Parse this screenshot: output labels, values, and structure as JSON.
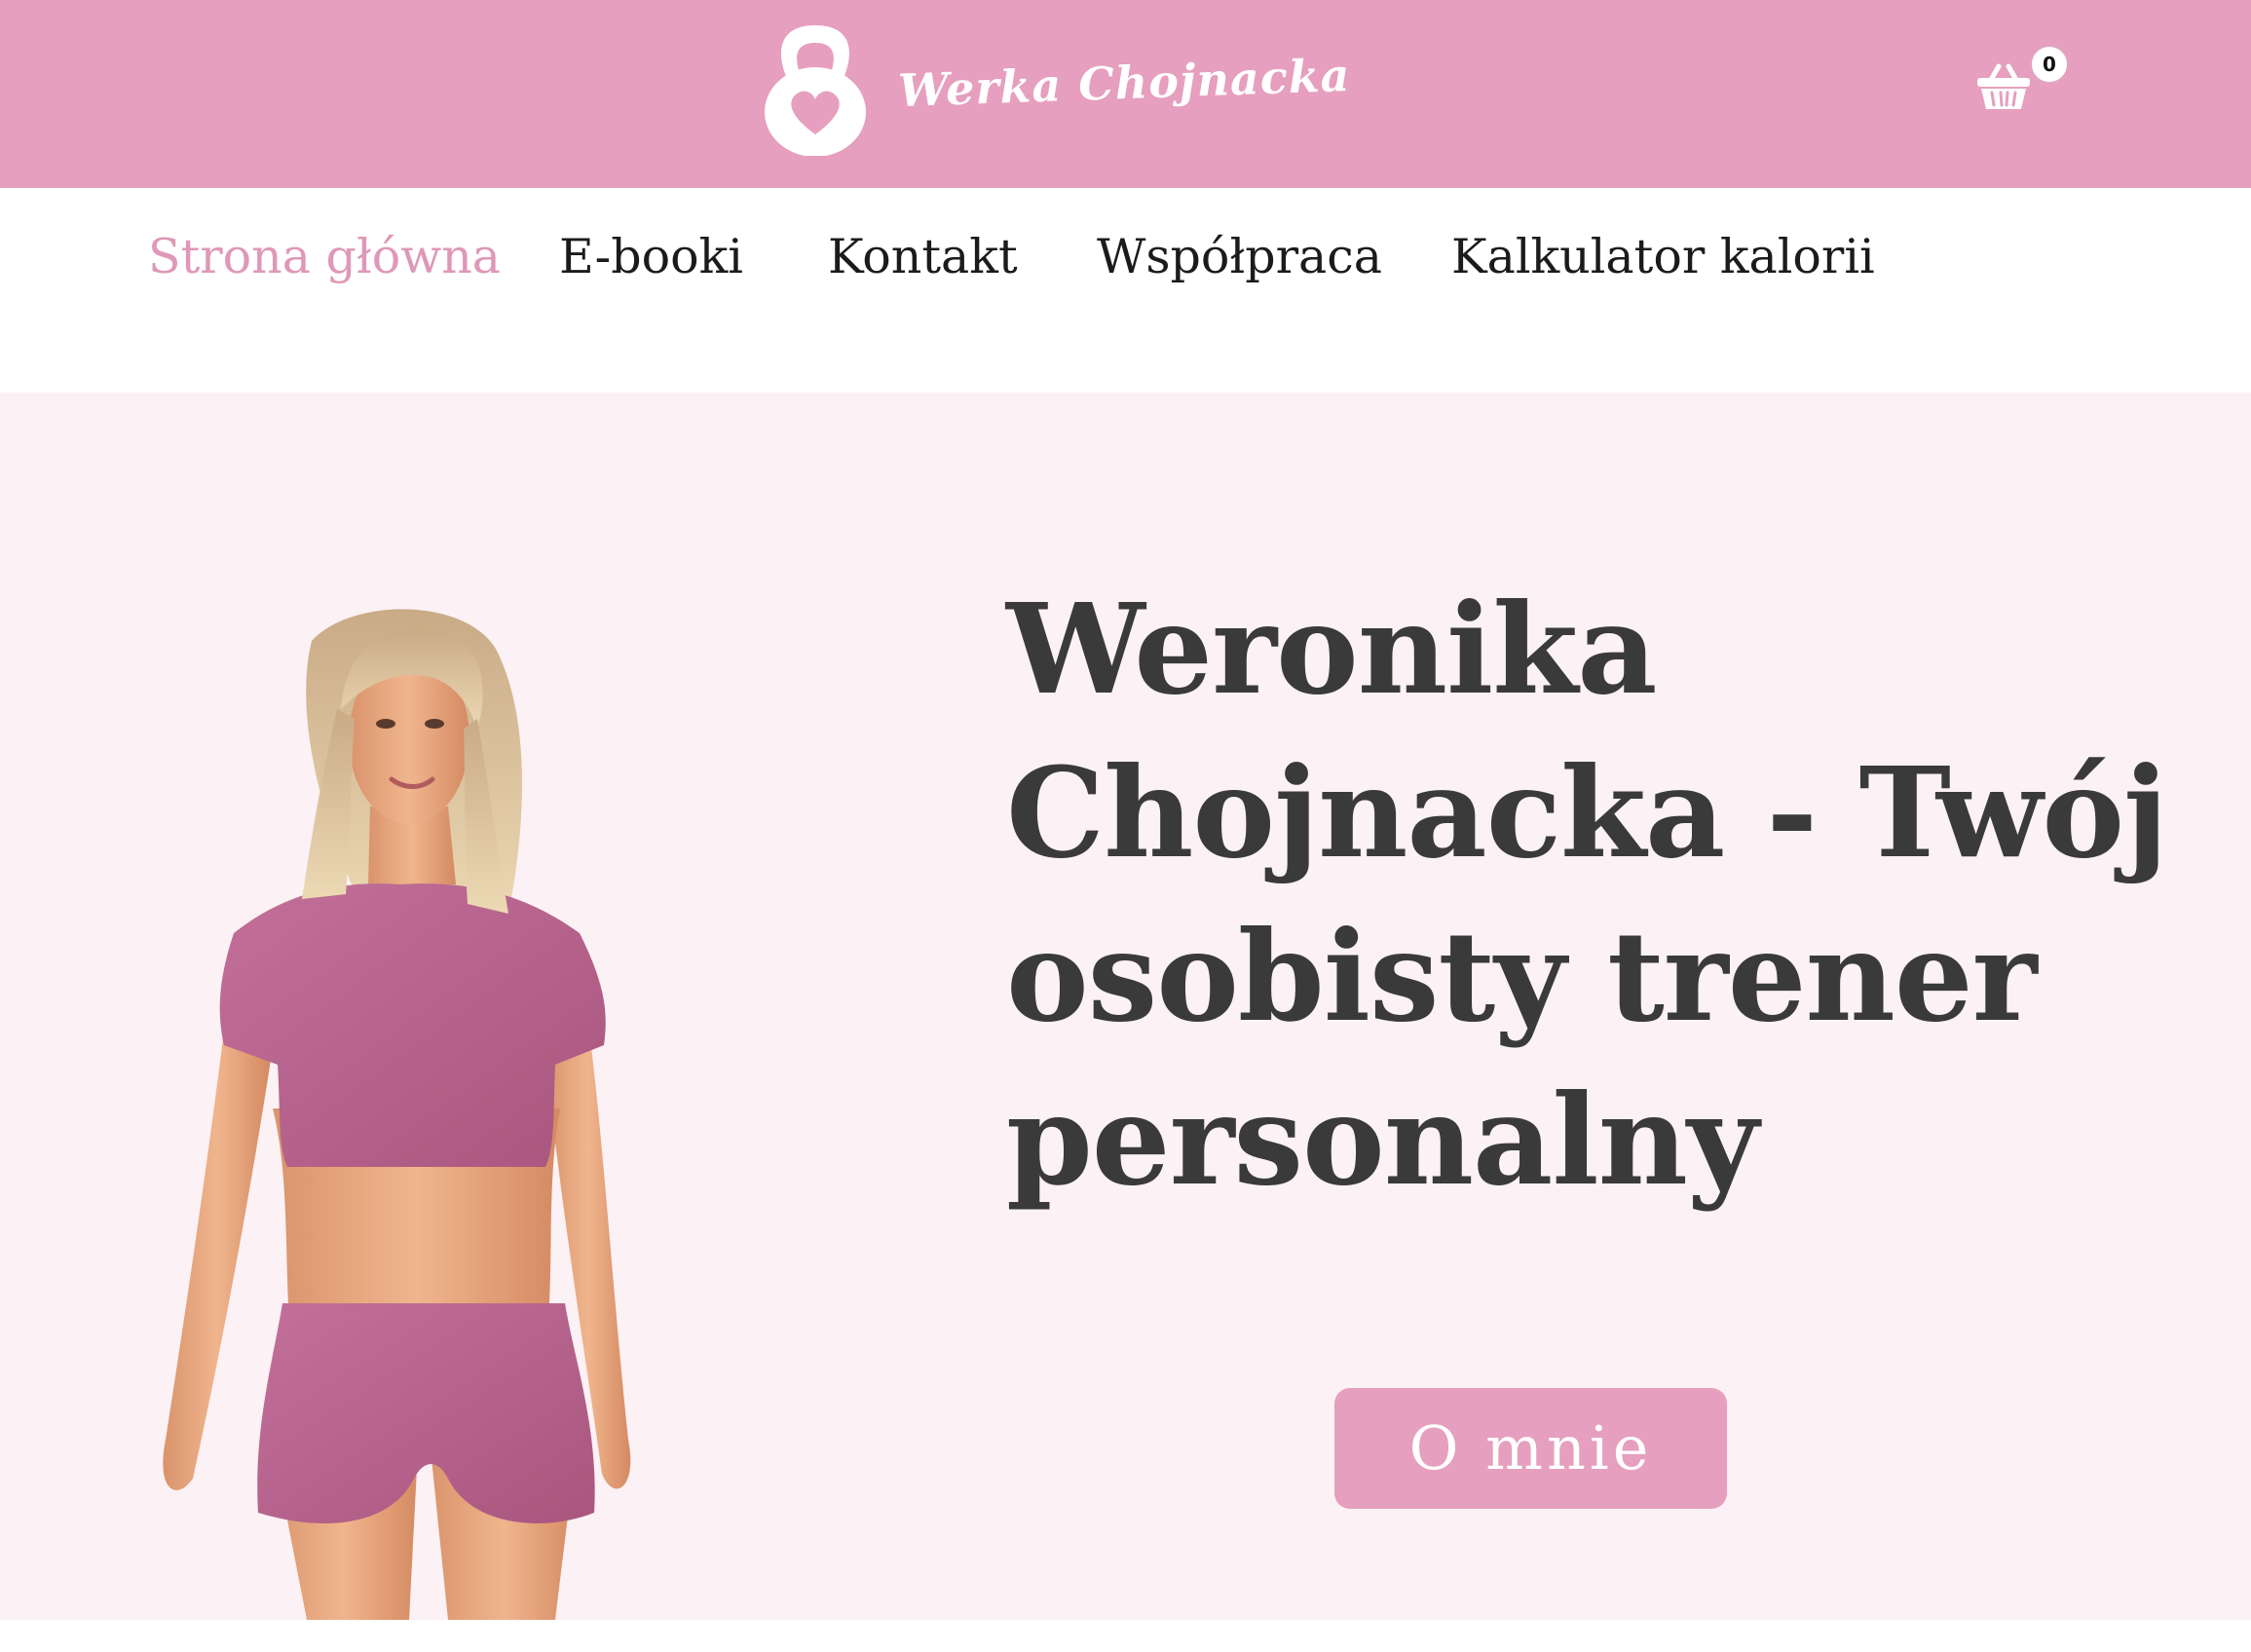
{
  "header": {
    "logo_text": "Werka Chojnacka",
    "cart_count": "0",
    "cart_icon": "basket-icon"
  },
  "nav": {
    "items": [
      {
        "label": "Strona główna",
        "active": true
      },
      {
        "label": "E-booki",
        "active": false
      },
      {
        "label": "Kontakt",
        "active": false
      },
      {
        "label": "Współpraca",
        "active": false
      },
      {
        "label": "Kalkulator kalorii",
        "active": false
      }
    ]
  },
  "hero": {
    "title": "Weronika Chojnacka - Twój osobisty trener personalny",
    "button_label": "O mnie"
  },
  "colors": {
    "brand_pink": "#e69fbe",
    "hero_bg": "#fcf1f4",
    "title_text": "#3a3a3a",
    "active_nav": "#df98b7"
  }
}
